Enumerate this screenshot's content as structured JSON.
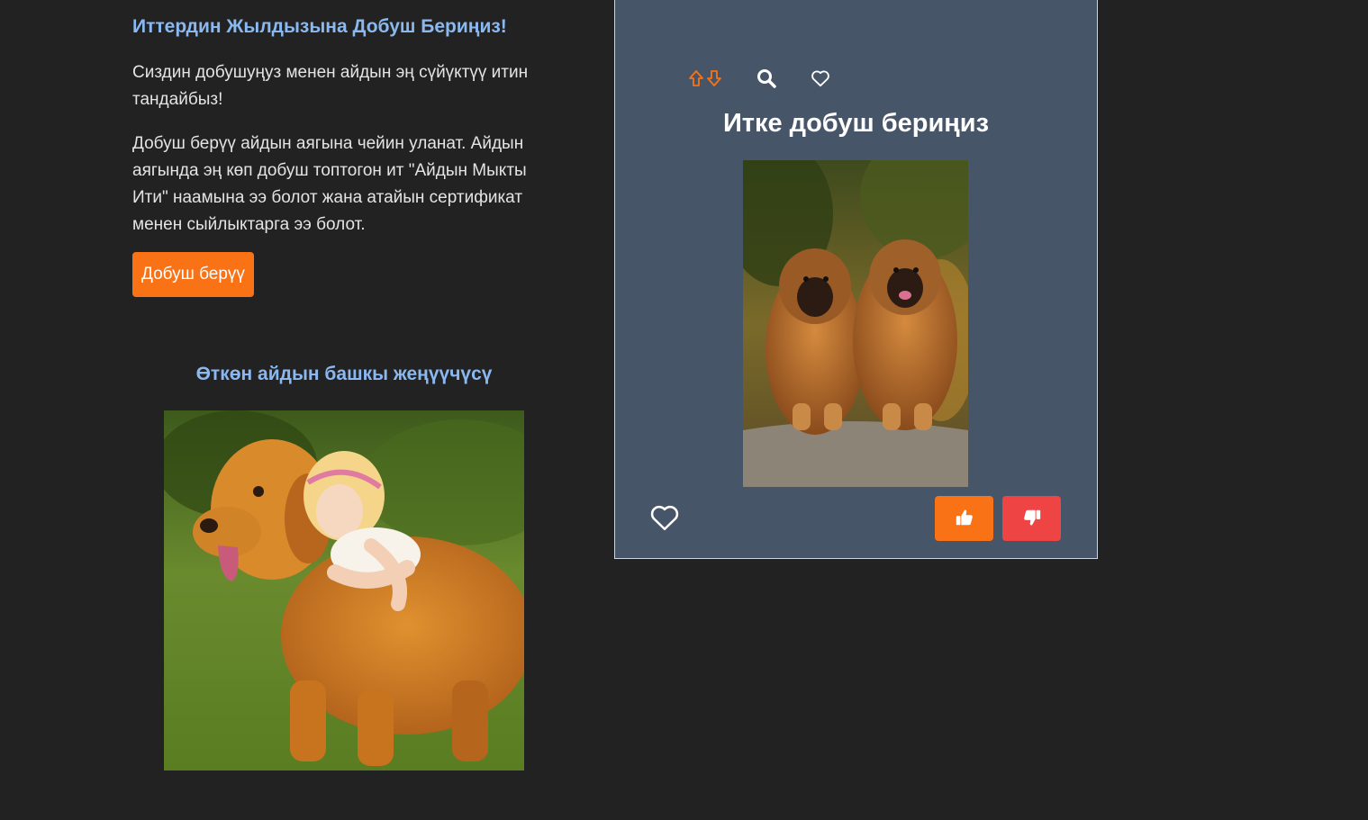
{
  "intro": {
    "title": "Иттердин Жылдызына Добуш Бериңиз!",
    "paragraph1": "Сиздин добушуңуз менен айдын эң сүйүктүү итин тандайбыз!",
    "paragraph2": "Добуш берүү айдын аягына чейин уланат. Айдын аягында эң көп добуш топтогон ит \"Айдын Мыкты Ити\" наамына ээ болот жана атайын сертификат менен сыйлыктарга ээ болот.",
    "vote_button": "Добуш берүү"
  },
  "winner": {
    "title": "Өткөн айдын башкы жеңүүчүсү"
  },
  "card": {
    "title": "Итке добуш бериңиз",
    "toolbar": {
      "sort_icon": "arrows-up-down-icon",
      "search_icon": "search-icon",
      "favorite_icon": "heart-outline-icon"
    },
    "favorite_icon": "heart-outline-icon",
    "like_icon": "thumbs-up-icon",
    "dislike_icon": "thumbs-down-icon"
  },
  "colors": {
    "background": "#222222",
    "heading_blue": "#8ab8f0",
    "accent_orange": "#f97316",
    "dislike_red": "#ef4444",
    "card_bg": "#475569"
  }
}
